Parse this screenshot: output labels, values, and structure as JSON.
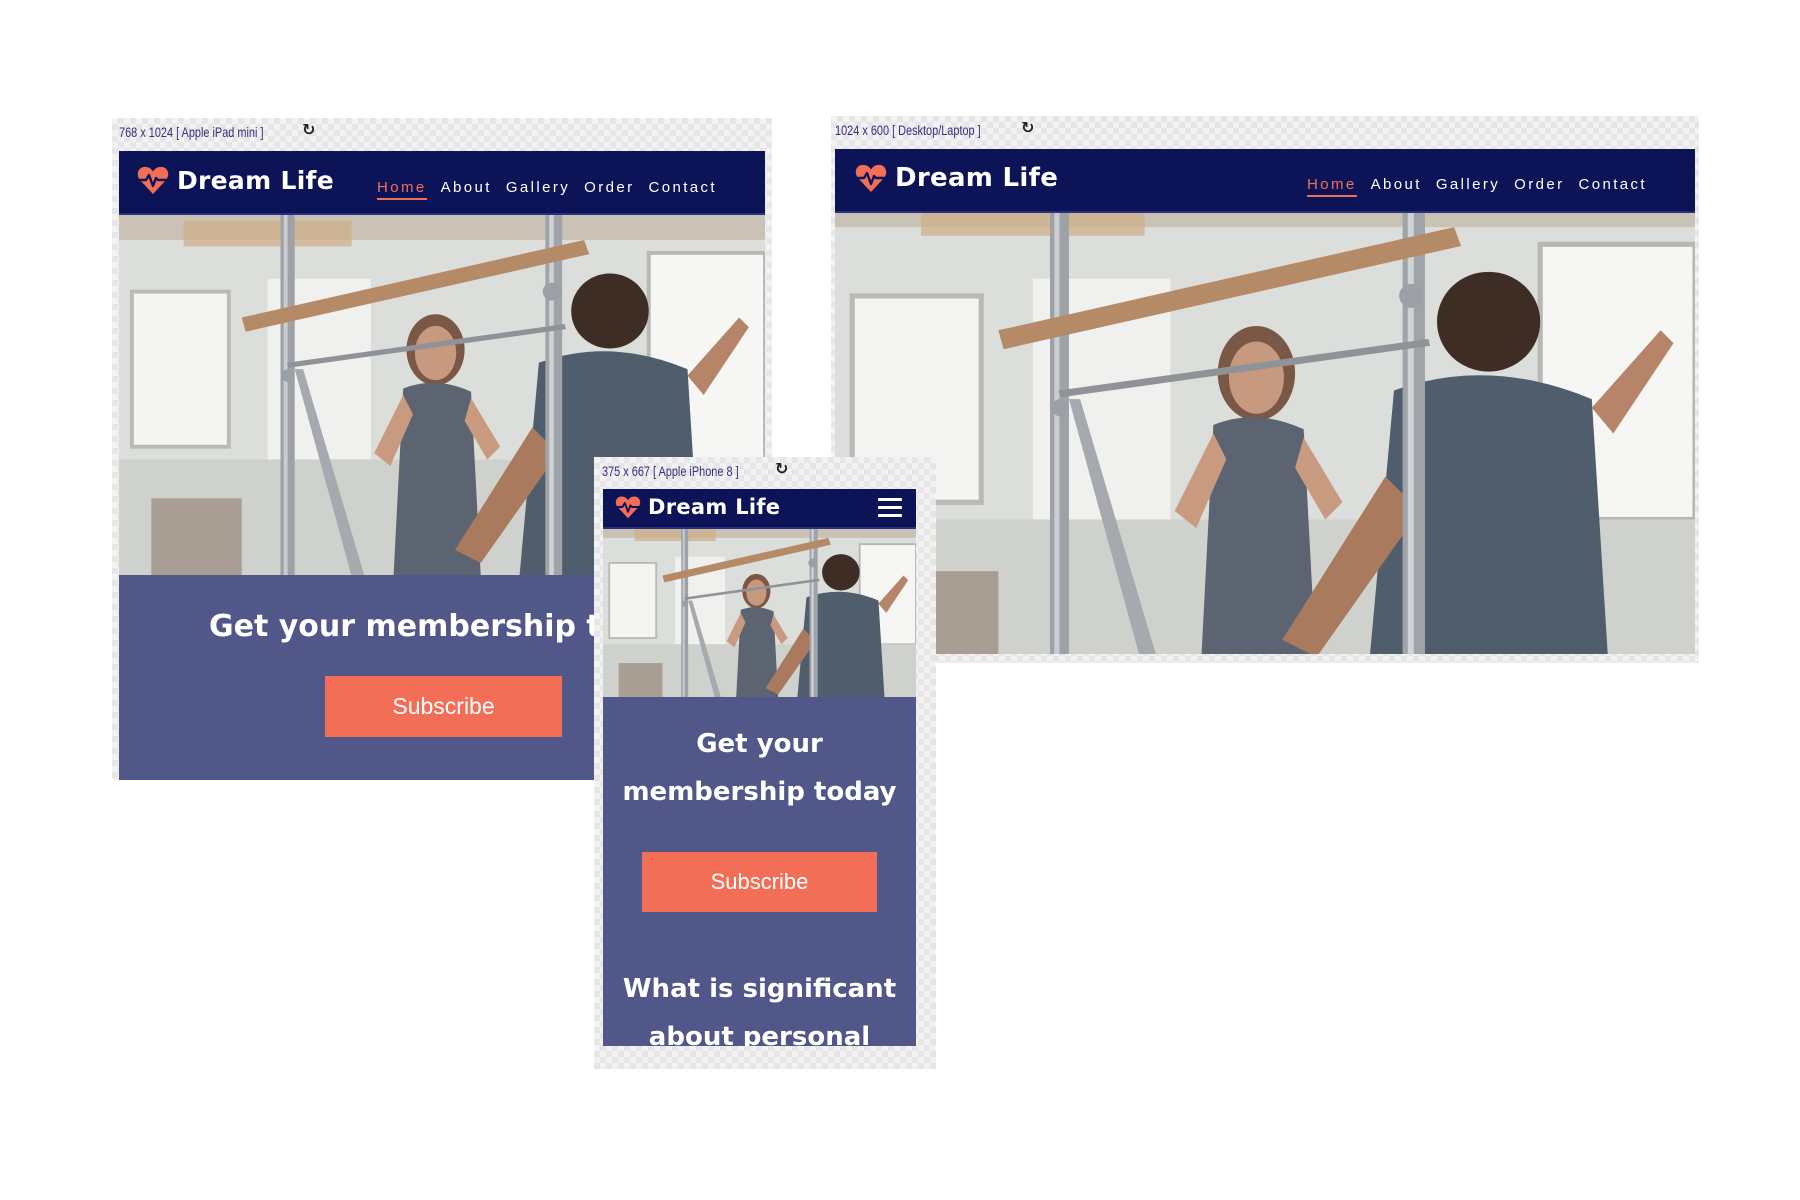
{
  "brand": {
    "name": "Dream Life",
    "accent": "#f36e57",
    "nav_bg": "#0c1357",
    "section_bg": "#515889"
  },
  "nav": {
    "links": [
      "Home",
      "About",
      "Gallery",
      "Order",
      "Contact"
    ],
    "active": "Home"
  },
  "tablet": {
    "label": "768 x 1024 [ Apple iPad mini ]",
    "rotate_icon": "rotate-icon",
    "cta_title": "Get your membership today",
    "button": "Subscribe"
  },
  "desktop": {
    "label": "1024 x 600 [ Desktop/Laptop ]",
    "rotate_icon": "rotate-icon"
  },
  "mobile": {
    "label": "375 x 667 [ Apple iPhone 8 ]",
    "rotate_icon": "rotate-icon",
    "menu_icon": "hamburger-menu-icon",
    "cta_title_line1": "Get your",
    "cta_title_line2": "membership today",
    "button": "Subscribe",
    "next_heading_line1": "What is significant",
    "next_heading_line2": "about personal"
  },
  "icons": {
    "logo": "heart-pulse-icon",
    "rotate": "↻"
  }
}
